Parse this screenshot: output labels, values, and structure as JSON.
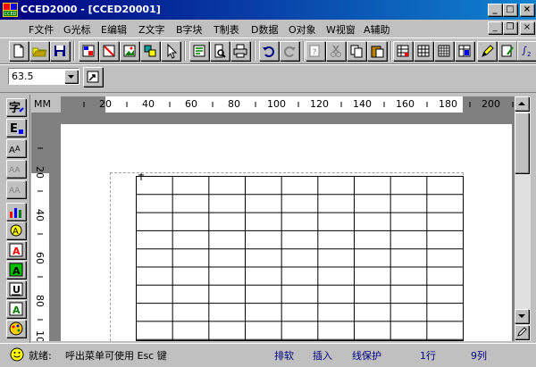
{
  "window": {
    "title": "CCED2000 - [CCED20001]",
    "accent": "#000080"
  },
  "menu": {
    "items": [
      {
        "label": "F文件"
      },
      {
        "label": "G光标"
      },
      {
        "label": "E编辑"
      },
      {
        "label": "Z文字"
      },
      {
        "label": "B字块"
      },
      {
        "label": "T制表"
      },
      {
        "label": "D数据"
      },
      {
        "label": "O对象"
      },
      {
        "label": "W视窗"
      },
      {
        "label": "A辅助"
      }
    ]
  },
  "format_bar": {
    "size_value": "63.5"
  },
  "ruler": {
    "unit": "MM",
    "h_labels": [
      "20",
      "40",
      "60",
      "80",
      "100",
      "120",
      "140",
      "160",
      "180",
      "200"
    ],
    "v_labels": [
      "20",
      "40",
      "60",
      "80",
      "10"
    ]
  },
  "status": {
    "ready": "就绪:",
    "hint": "呼出菜单可使用 Esc 键",
    "mode_typeset": "排软",
    "mode_insert": "插入",
    "mode_lineprotect": "线保护",
    "row": "1行",
    "col": "9列",
    "status_color": "#000080"
  },
  "table": {
    "rows": 10,
    "cols": 9
  }
}
